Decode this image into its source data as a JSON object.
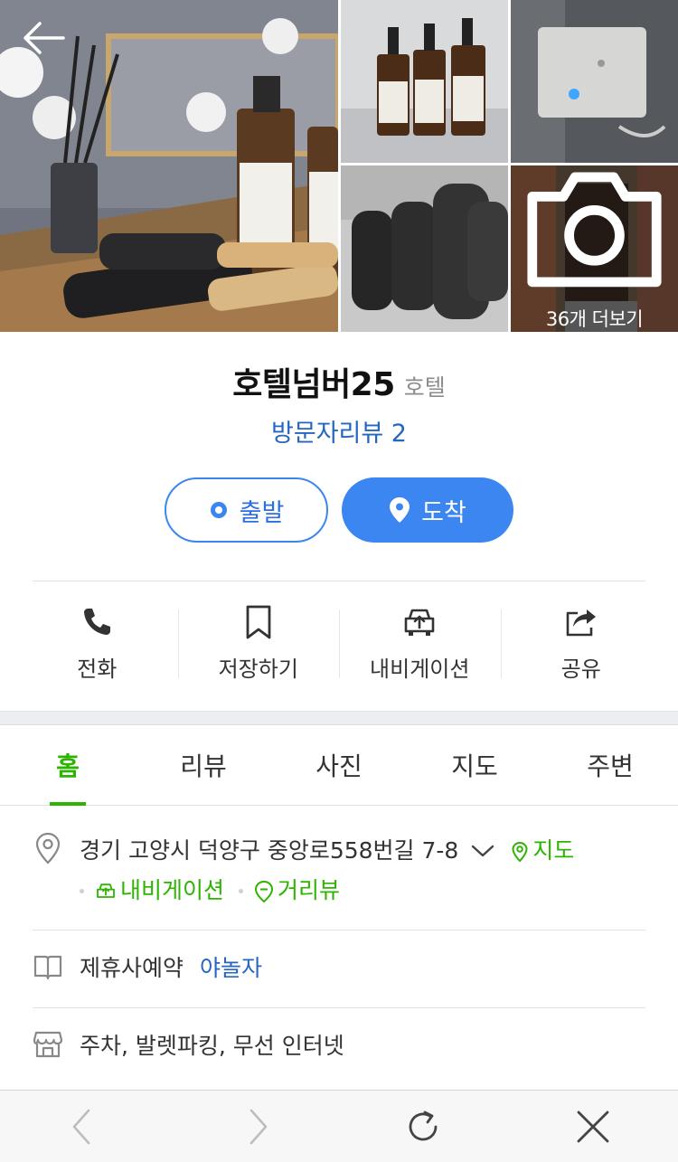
{
  "gallery": {
    "more_count_label": "36개 더보기"
  },
  "place": {
    "name": "호텔넘버25",
    "category": "호텔",
    "review_link": "방문자리뷰 2"
  },
  "route_buttons": {
    "start": "출발",
    "destination": "도착"
  },
  "actions": [
    {
      "label": "전화",
      "icon": "phone-icon"
    },
    {
      "label": "저장하기",
      "icon": "bookmark-icon"
    },
    {
      "label": "내비게이션",
      "icon": "car-navigation-icon"
    },
    {
      "label": "공유",
      "icon": "share-icon"
    }
  ],
  "tabs": [
    {
      "label": "홈",
      "active": true
    },
    {
      "label": "리뷰",
      "active": false
    },
    {
      "label": "사진",
      "active": false
    },
    {
      "label": "지도",
      "active": false
    },
    {
      "label": "주변",
      "active": false
    }
  ],
  "address": {
    "text": "경기 고양시 덕양구 중앙로558번길 7-8",
    "map_link": "지도",
    "navigation_link": "내비게이션",
    "streetview_link": "거리뷰"
  },
  "booking": {
    "label": "제휴사예약",
    "partner": "야놀자"
  },
  "amenities": {
    "text": "주차, 발렛파킹, 무선 인터넷"
  },
  "colors": {
    "accent_blue": "#3c86f2",
    "link_blue": "#2466c1",
    "green": "#2db400"
  }
}
